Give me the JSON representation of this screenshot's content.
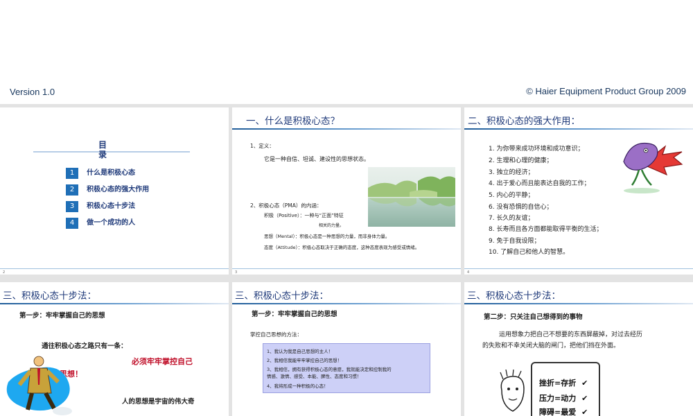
{
  "header": {
    "version": "Version 1.0",
    "copyright": "© Haier Equipment Product Group 2009"
  },
  "slides": {
    "s1": {
      "toc_title": "目录",
      "items": [
        {
          "num": "1",
          "label": "什么是积极心态"
        },
        {
          "num": "2",
          "label": "积极心态的强大作用"
        },
        {
          "num": "3",
          "label": "积极心态十步法"
        },
        {
          "num": "4",
          "label": "做一个成功的人"
        }
      ],
      "page": "2"
    },
    "s2": {
      "title": "一、什么是积极心态？",
      "def_label": "1、定义：",
      "def_text": "它是一种自信、坦诚、建设性的思想状态。",
      "pma_label": "2、积极心态（PMA）的内涵：",
      "positive": "积极（Positive）：一种与“正面”特征",
      "positive_cont": "相关的力量。",
      "mental": "思想（Mental）：积极心态是一种思想的力量，而非身体力量。",
      "attitude": "态度（Attitude）：积极心态取决于正确的态度，这种态度表现为感受或情绪。",
      "page": "3"
    },
    "s3": {
      "title": "二、积极心态的强大作用：",
      "items": [
        "1. 为你带来成功环境和成功意识；",
        "2. 生理和心理的健康；",
        "3. 独立的经济；",
        "4. 出于爱心而且能表达自我的工作；",
        "5. 内心的平静；",
        "6. 没有恐惧的自信心；",
        "7. 长久的友谊；",
        "8. 长寿而且各方面都能取得平衡的生活；",
        "9. 免于自我设限；",
        "10. 了解自己和他人的智慧。"
      ],
      "page": "4"
    },
    "s4": {
      "title": "三、积极心态十步法：",
      "step": "第一步：牢牢掌握自己的思想",
      "line1": "通往积极心态之路只有一条：",
      "red1": "必须牢牢掌控自己",
      "red2": "思想！",
      "line3": "人的思想是宇宙的伟大奇"
    },
    "s5": {
      "title": "三、积极心态十步法：",
      "step": "第一步：牢牢掌握自己的思想",
      "method": "掌控自己思想的方法：",
      "box": [
        "1、我认为我是自己思想的主人！",
        "2、我相信我能牢牢掌控自己的思想！",
        "3、我相信，拥有获得积极心态的意愿，我就能决定和控制我的",
        "情感、激情、感受、本能、脾性、态度和习惯！",
        "4、我将形成一种积极的心态！"
      ]
    },
    "s6": {
      "title": "三、积极心态十步法：",
      "step": "第二步：只关注自己想得到的事物",
      "para1": "运用想象力把自己不想要的东西屏蔽掉，对过去经历",
      "para2": "的失败和不幸关闭大脑的闸门，把他们挡在外面。",
      "board": [
        "挫折=存折",
        "压力=动力",
        "障碍=最爱"
      ]
    }
  }
}
